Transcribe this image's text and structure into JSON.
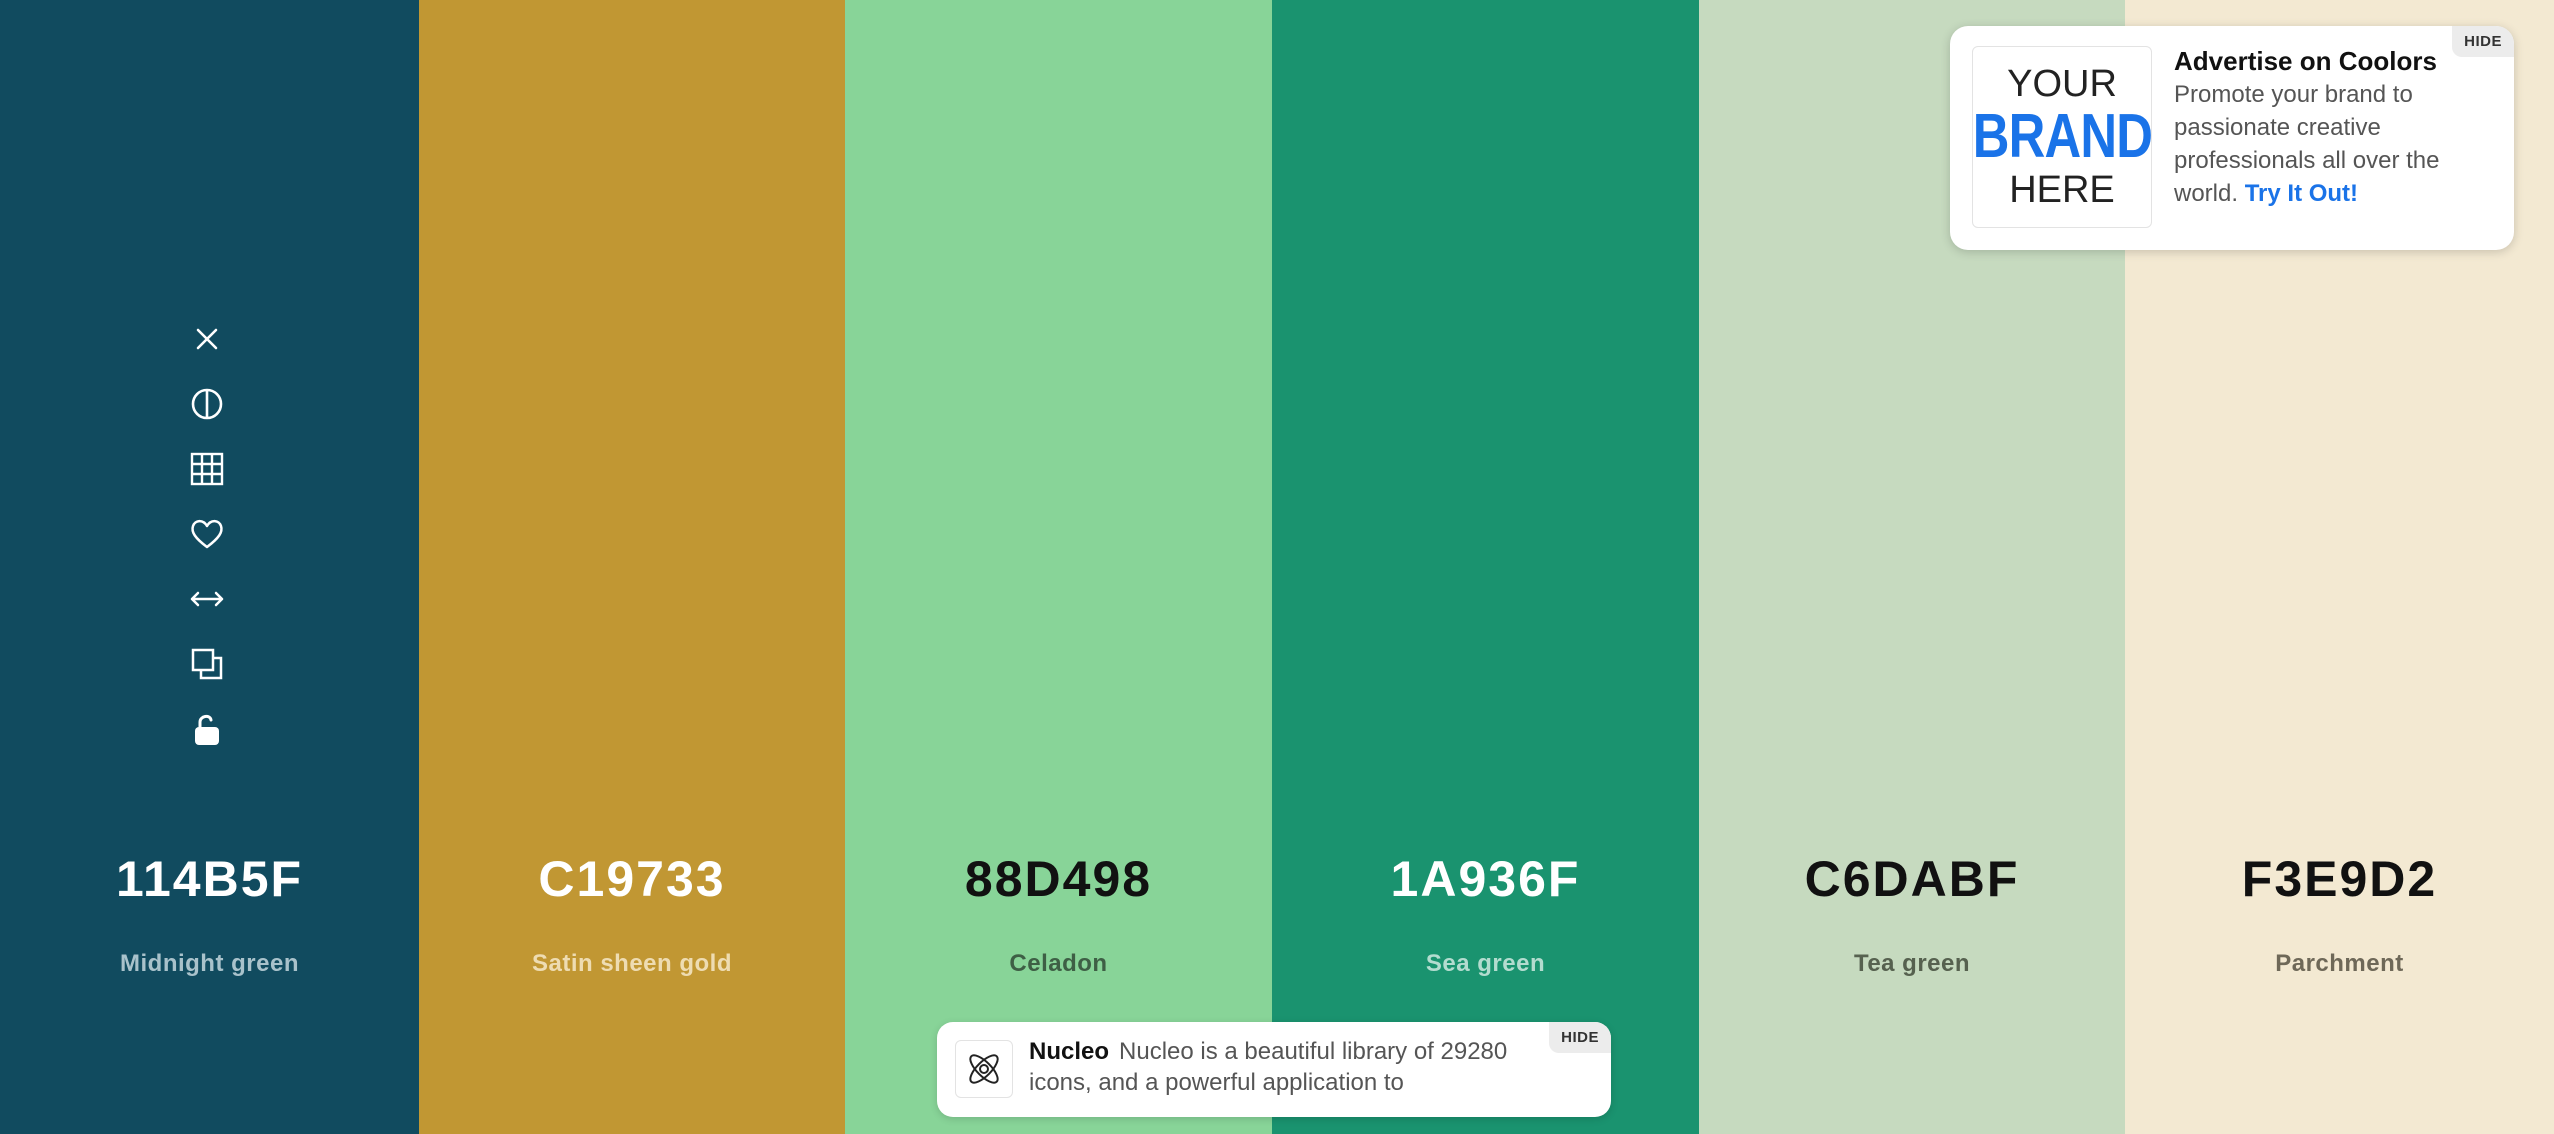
{
  "swatches": [
    {
      "hex": "114B5F",
      "name": "Midnight green",
      "bg": "#114B5F",
      "hex_color": "#FFFFFF",
      "name_color": "#A9C2CB"
    },
    {
      "hex": "C19733",
      "name": "Satin sheen gold",
      "bg": "#C19733",
      "hex_color": "#FFFFFF",
      "name_color": "#EEDCB2"
    },
    {
      "hex": "88D498",
      "name": "Celadon",
      "bg": "#88D498",
      "hex_color": "#111111",
      "name_color": "#3E5F45"
    },
    {
      "hex": "1A936F",
      "name": "Sea green",
      "bg": "#1A936F",
      "hex_color": "#FFFFFF",
      "name_color": "#B3DCCF"
    },
    {
      "hex": "C6DABF",
      "name": "Tea green",
      "bg": "#C6DABF",
      "hex_color": "#111111",
      "name_color": "#56614F"
    },
    {
      "hex": "F3E9D2",
      "name": "Parchment",
      "bg": "#F3E9D2",
      "hex_color": "#111111",
      "name_color": "#6E6858"
    }
  ],
  "toolbar": {
    "icons": [
      "close-icon",
      "contrast-icon",
      "shades-grid-icon",
      "heart-icon",
      "drag-arrows-icon",
      "copy-icon",
      "unlock-icon"
    ]
  },
  "ad_top": {
    "hide_label": "HIDE",
    "logo_line1": "YOUR",
    "logo_line2": "BRAND",
    "logo_line3": "HERE",
    "title": "Advertise on Coolors",
    "body": "Promote your brand to passionate creative professionals all over the world.",
    "cta": "Try It Out!"
  },
  "ad_bottom": {
    "hide_label": "HIDE",
    "title": "Nucleo",
    "body": "Nucleo is a beautiful library of 29280 icons, and a powerful application to"
  }
}
